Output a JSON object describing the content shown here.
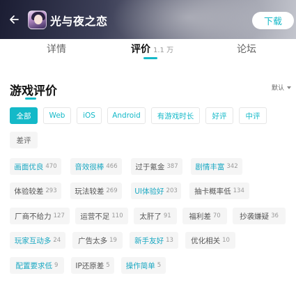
{
  "header": {
    "app_title": "光与夜之恋",
    "download_label": "下载",
    "back_icon": "arrow-left-icon"
  },
  "tabs": [
    {
      "label": "详情",
      "active": false
    },
    {
      "label": "评价",
      "count": "1.1 万",
      "active": true
    },
    {
      "label": "论坛",
      "active": false
    }
  ],
  "section": {
    "title": "游戏评价",
    "sort_label": "默认"
  },
  "filters": [
    {
      "label": "全部",
      "selected": true
    },
    {
      "label": "Web"
    },
    {
      "label": "iOS"
    },
    {
      "label": "Android"
    },
    {
      "label": "有游戏时长"
    },
    {
      "label": "好评"
    },
    {
      "label": "中评"
    },
    {
      "label": "差评"
    }
  ],
  "tags": [
    {
      "label": "画面优良",
      "count": "470",
      "positive": true
    },
    {
      "label": "音效很棒",
      "count": "466",
      "positive": true
    },
    {
      "label": "过于氪金",
      "count": "387",
      "positive": false
    },
    {
      "label": "剧情丰富",
      "count": "342",
      "positive": true
    },
    {
      "label": "体验较差",
      "count": "293",
      "positive": false
    },
    {
      "label": "玩法较差",
      "count": "269",
      "positive": false
    },
    {
      "label": "UI体验好",
      "count": "203",
      "positive": true
    },
    {
      "label": "抽卡概率低",
      "count": "134",
      "positive": false
    },
    {
      "label": "厂商不给力",
      "count": "127",
      "positive": false
    },
    {
      "label": "运营不足",
      "count": "110",
      "positive": false
    },
    {
      "label": "太肝了",
      "count": "91",
      "positive": false
    },
    {
      "label": "福利差",
      "count": "70",
      "positive": false
    },
    {
      "label": "抄袭嫌疑",
      "count": "36",
      "positive": false
    },
    {
      "label": "玩家互动多",
      "count": "24",
      "positive": true
    },
    {
      "label": "广告太多",
      "count": "19",
      "positive": false
    },
    {
      "label": "新手友好",
      "count": "13",
      "positive": true
    },
    {
      "label": "优化相关",
      "count": "10",
      "positive": false
    },
    {
      "label": "配置要求低",
      "count": "9",
      "positive": true
    },
    {
      "label": "IP还原差",
      "count": "5",
      "positive": false
    },
    {
      "label": "操作简单",
      "count": "5",
      "positive": true
    }
  ],
  "colors": {
    "accent": "#14b9c8",
    "positive_text": "#1aa8c2",
    "negative_text": "#555555",
    "tag_bg": "#f5f5f5"
  }
}
